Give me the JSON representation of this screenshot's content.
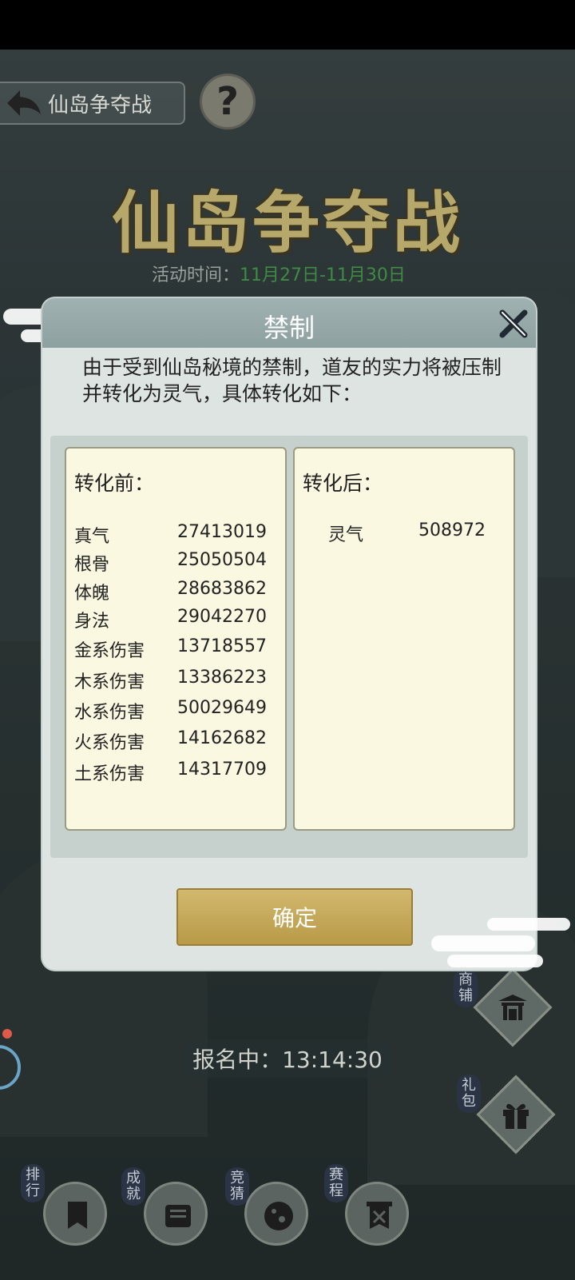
{
  "header": {
    "back_label": "仙岛争夺战",
    "help_symbol": "?"
  },
  "banner": {
    "title": "仙岛争夺战",
    "time_label": "活动时间：",
    "time_value": "11月27日-11月30日"
  },
  "dialog": {
    "title": "禁制",
    "description": "由于受到仙岛秘境的禁制，道友的实力将被压制并转化为灵气，具体转化如下：",
    "before_header": "转化前：",
    "after_header": "转化后：",
    "before_rows": [
      {
        "name": "真气",
        "value": "27413019"
      },
      {
        "name": "根骨",
        "value": "25050504"
      },
      {
        "name": "体魄",
        "value": "28683862"
      },
      {
        "name": "身法",
        "value": "29042270"
      },
      {
        "name": "金系伤害",
        "value": "13718557"
      },
      {
        "name": "木系伤害",
        "value": "13386223"
      },
      {
        "name": "水系伤害",
        "value": "50029649"
      },
      {
        "name": "火系伤害",
        "value": "14162682"
      },
      {
        "name": "土系伤害",
        "value": "14317709"
      }
    ],
    "after_rows": [
      {
        "name": "灵气",
        "value": "508972"
      }
    ],
    "confirm_label": "确定"
  },
  "status": {
    "countdown_text": "报名中：13:14:30"
  },
  "side_buttons": {
    "shop_label": "商铺",
    "gift_label": "礼包"
  },
  "bottom_nav": {
    "rank_label": "排行",
    "achievement_label": "成就",
    "guess_label": "竞猜",
    "schedule_label": "赛程"
  },
  "colors": {
    "gold_title": "#b6a86a",
    "time_green": "#3f8a45",
    "confirm_gold": "#c9ad5e",
    "panel_cream": "#fbf8e1"
  }
}
